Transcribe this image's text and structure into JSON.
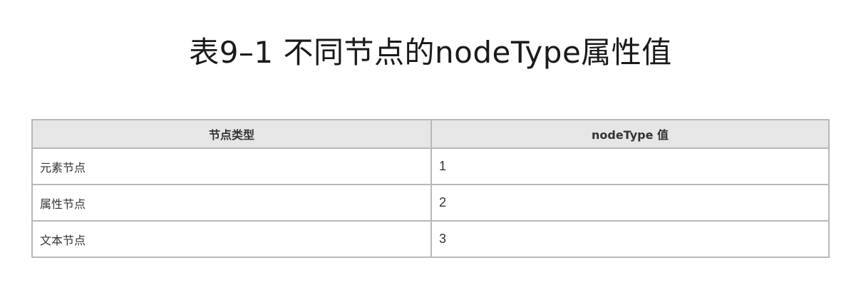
{
  "title": "表9–1 不同节点的nodeType属性值",
  "table": {
    "headers": [
      "节点类型",
      "nodeType 值"
    ],
    "rows": [
      {
        "type": "元素节点",
        "value": "1"
      },
      {
        "type": "属性节点",
        "value": "2"
      },
      {
        "type": "文本节点",
        "value": "3"
      }
    ]
  }
}
